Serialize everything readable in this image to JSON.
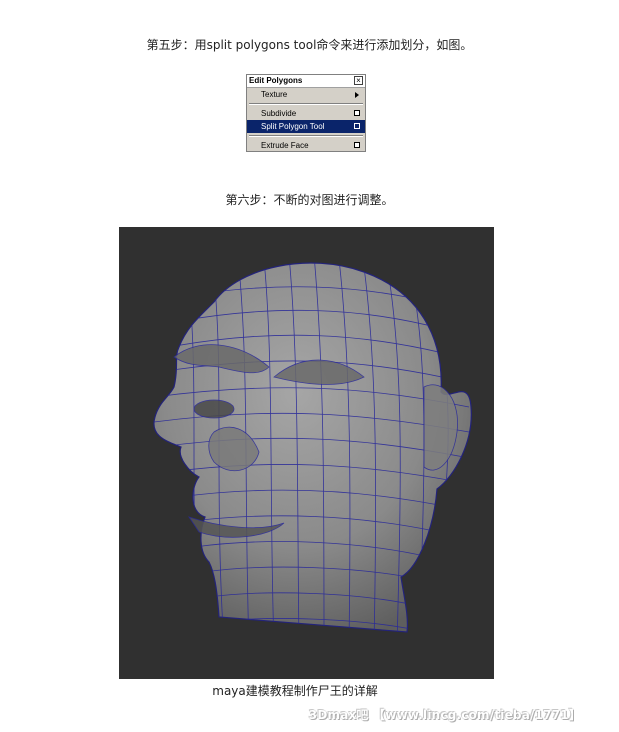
{
  "step5_text": "第五步：用split polygons tool命令来进行添加划分，如图。",
  "menu": {
    "title": "Edit Polygons",
    "close_glyph": "×",
    "items": [
      {
        "label": "Texture"
      },
      {
        "label": "Subdivide"
      },
      {
        "label": "Split Polygon Tool"
      },
      {
        "label": "Extrude Face"
      }
    ]
  },
  "step6_text": "第六步：不断的对图进行调整。",
  "image_caption": "maya建模教程制作尸王的详解",
  "watermark": "3Dmax吧 【www.lincg.com/tieba/1771】",
  "colors": {
    "wire": "#2a2a9a",
    "background": "#303030",
    "head": "#8a8a8a",
    "menu_highlight": "#0a246a"
  }
}
